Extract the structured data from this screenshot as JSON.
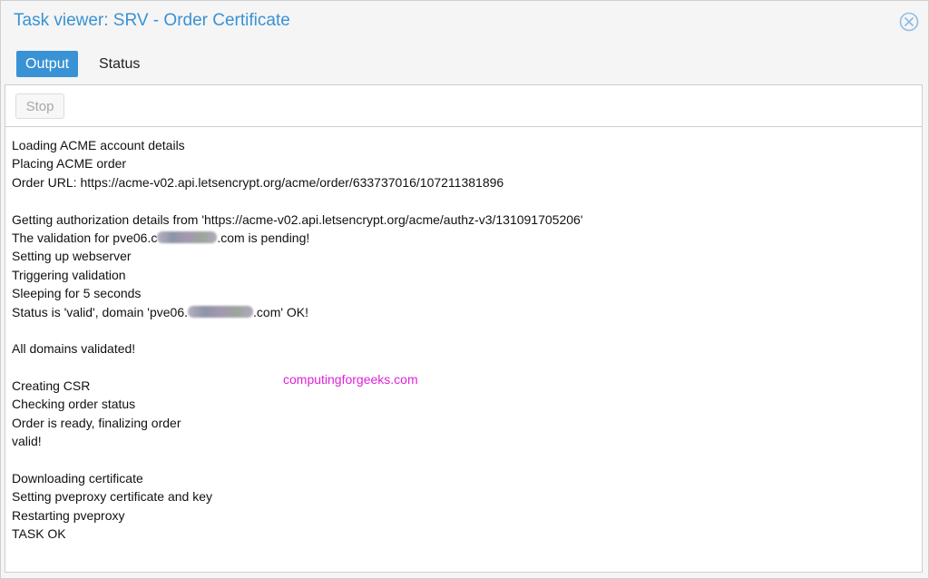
{
  "window": {
    "title": "Task viewer: SRV - Order Certificate"
  },
  "tabs": [
    {
      "label": "Output",
      "active": true
    },
    {
      "label": "Status",
      "active": false
    }
  ],
  "toolbar": {
    "stop_label": "Stop",
    "stop_disabled": true
  },
  "log": {
    "lines": [
      "Loading ACME account details",
      "Placing ACME order",
      "Order URL: https://acme-v02.api.letsencrypt.org/acme/order/633737016/107211381896",
      "",
      "Getting authorization details from 'https://acme-v02.api.letsencrypt.org/acme/authz-v3/131091705206'",
      "The validation for pve06.c",
      ".com is pending!",
      "Setting up webserver",
      "Triggering validation",
      "Sleeping for 5 seconds",
      "Status is 'valid', domain 'pve06.",
      ".com' OK!",
      "",
      "All domains validated!",
      "",
      "Creating CSR",
      "Checking order status",
      "Order is ready, finalizing order",
      "valid!",
      "",
      "Downloading certificate",
      "Setting pveproxy certificate and key",
      "Restarting pveproxy",
      "TASK OK"
    ]
  },
  "watermark": "computingforgeeks.com",
  "colors": {
    "accent": "#3892d4",
    "watermark": "#e020d8",
    "text": "#111111"
  },
  "icons": {
    "close": "close-circle-icon"
  }
}
